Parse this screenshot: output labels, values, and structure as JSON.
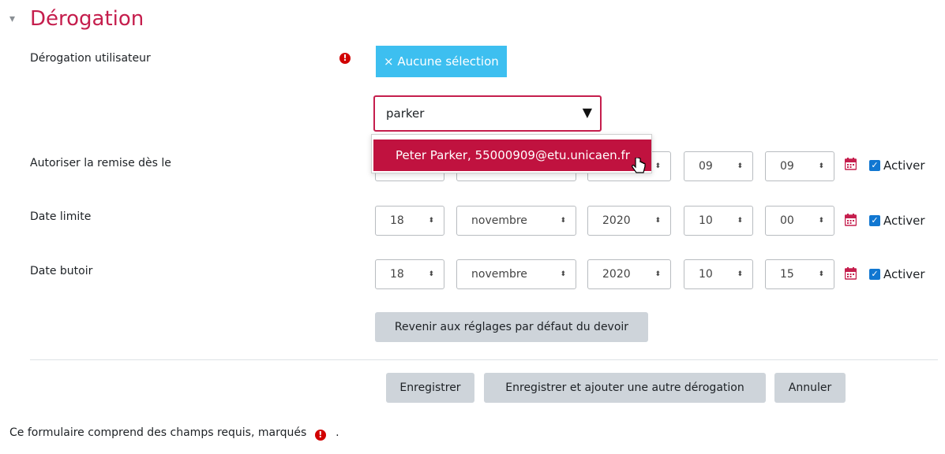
{
  "section": {
    "toggle_glyph": "▾",
    "title": "Dérogation"
  },
  "user_override": {
    "label": "Dérogation utilisateur",
    "required_glyph": "!",
    "chip_label": "× Aucune sélection",
    "search_value": "parker",
    "dropdown_glyph": "▼",
    "suggestion": "Peter Parker, 55000909@etu.unicaen.fr"
  },
  "rows": [
    {
      "label": "Autoriser la remise dès le",
      "day": "",
      "month": "",
      "year": "",
      "hour": "09",
      "minute": "09",
      "enable": "Activer"
    },
    {
      "label": "Date limite",
      "day": "18",
      "month": "novembre",
      "year": "2020",
      "hour": "10",
      "minute": "00",
      "enable": "Activer"
    },
    {
      "label": "Date butoir",
      "day": "18",
      "month": "novembre",
      "year": "2020",
      "hour": "10",
      "minute": "15",
      "enable": "Activer"
    }
  ],
  "icons": {
    "select_arrow": "⬍",
    "calendar": "calendar-icon",
    "check": "✓"
  },
  "buttons": {
    "reset": "Revenir aux réglages par défaut du devoir",
    "save": "Enregistrer",
    "save_add": "Enregistrer et ajouter une autre dérogation",
    "cancel": "Annuler"
  },
  "footer": {
    "text": "Ce formulaire comprend des champs requis, marqués",
    "suffix": "."
  },
  "colors": {
    "accent": "#c51e4d",
    "chip": "#3dbff0",
    "required": "#d10000",
    "checkbox": "#1177d1"
  }
}
